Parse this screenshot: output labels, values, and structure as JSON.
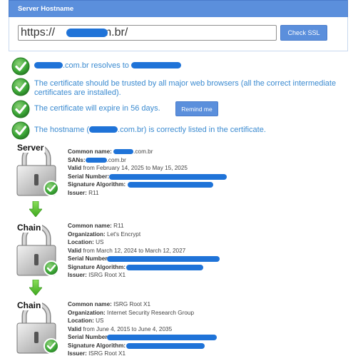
{
  "header": {
    "title": "Server Hostname"
  },
  "form": {
    "url_value": "https://          .com.br/",
    "check_button": "Check SSL"
  },
  "results": [
    {
      "pre": "",
      "post": ".com.br resolves to"
    },
    {
      "text": "The certificate should be trusted by all major web browsers (all the correct intermediate certificates are installed)."
    },
    {
      "text": "The certificate will expire in 56 days.",
      "button": "Remind me"
    },
    {
      "pre": "The hostname (",
      "post": ".com.br) is correctly listed in the certificate."
    }
  ],
  "chain": [
    {
      "label": "Server",
      "fields": {
        "common_name_label": "Common name:",
        "common_name": ".com.br",
        "sans_label": "SANs:",
        "sans": ".com.br",
        "valid_label": "Valid",
        "valid": "from February 14, 2025 to May 15, 2025",
        "serial_label": "Serial Number:",
        "sig_label": "Signature Algorithm:",
        "issuer_label": "Issuer:",
        "issuer": "R11"
      }
    },
    {
      "label": "Chain",
      "fields": {
        "common_name_label": "Common name:",
        "common_name": "R11",
        "org_label": "Organization:",
        "org": "Let's Encrypt",
        "loc_label": "Location:",
        "loc": "US",
        "valid_label": "Valid",
        "valid": "from March 12, 2024 to March 12, 2027",
        "serial_label": "Serial Number:",
        "sig_label": "Signature Algorithm:",
        "issuer_label": "Issuer:",
        "issuer": "ISRG Root X1"
      }
    },
    {
      "label": "Chain",
      "fields": {
        "common_name_label": "Common name:",
        "common_name": "ISRG Root X1",
        "org_label": "Organization:",
        "org": "Internet Security Research Group",
        "loc_label": "Location:",
        "loc": "US",
        "valid_label": "Valid",
        "valid": "from June 4, 2015 to June 4, 2035",
        "serial_label": "Serial Number:",
        "sig_label": "Signature Algorithm:",
        "issuer_label": "Issuer:",
        "issuer": "ISRG Root X1"
      }
    }
  ],
  "colors": {
    "accent": "#5b8fdc",
    "result_text": "#3a8ad0",
    "check_green": "#3aa535",
    "redaction": "#1f73d8"
  },
  "icons": [
    "check-circle-icon",
    "padlock-icon",
    "down-arrow-icon"
  ]
}
